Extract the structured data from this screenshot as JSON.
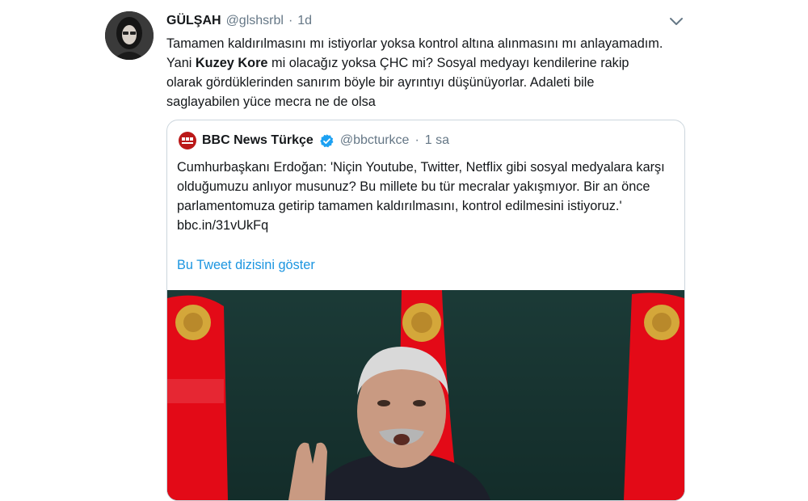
{
  "tweet": {
    "display_name": "GÜLŞAH",
    "handle": "@glshsrbl",
    "separator": "·",
    "timestamp": "1d",
    "text_part1": "Tamamen kaldırılmasını mı istiyorlar yoksa kontrol altına alınmasını mı anlayamadım. Yani ",
    "text_bold": "Kuzey Kore",
    "text_part2": " mi olacağız yoksa ÇHC mi? Sosyal medyayı kendilerine rakip olarak gördüklerinden sanırım böyle bir ayrıntıyı düşünüyorlar. Adaleti bile saglayabilen yüce mecra ne de olsa"
  },
  "quoted_tweet": {
    "display_name": "BBC News Türkçe",
    "handle": "@bbcturkce",
    "separator": "·",
    "timestamp": "1 sa",
    "text": "Cumhurbaşkanı Erdoğan: 'Niçin Youtube, Twitter, Netflix gibi sosyal medyalara karşı olduğumuzu anlıyor musunuz? Bu millete bu tür mecralar yakışmıyor. Bir an önce parlamentomuza getirip tamamen kaldırılmasını, kontrol edilmesini istiyoruz.'",
    "link": "bbc.in/31vUkFq",
    "show_thread": "Bu Tweet dizisini göster"
  },
  "colors": {
    "accent": "#1b95e0",
    "verified": "#1da1f2",
    "bbc_red": "#bb1919",
    "flag_red": "#e30a17"
  }
}
